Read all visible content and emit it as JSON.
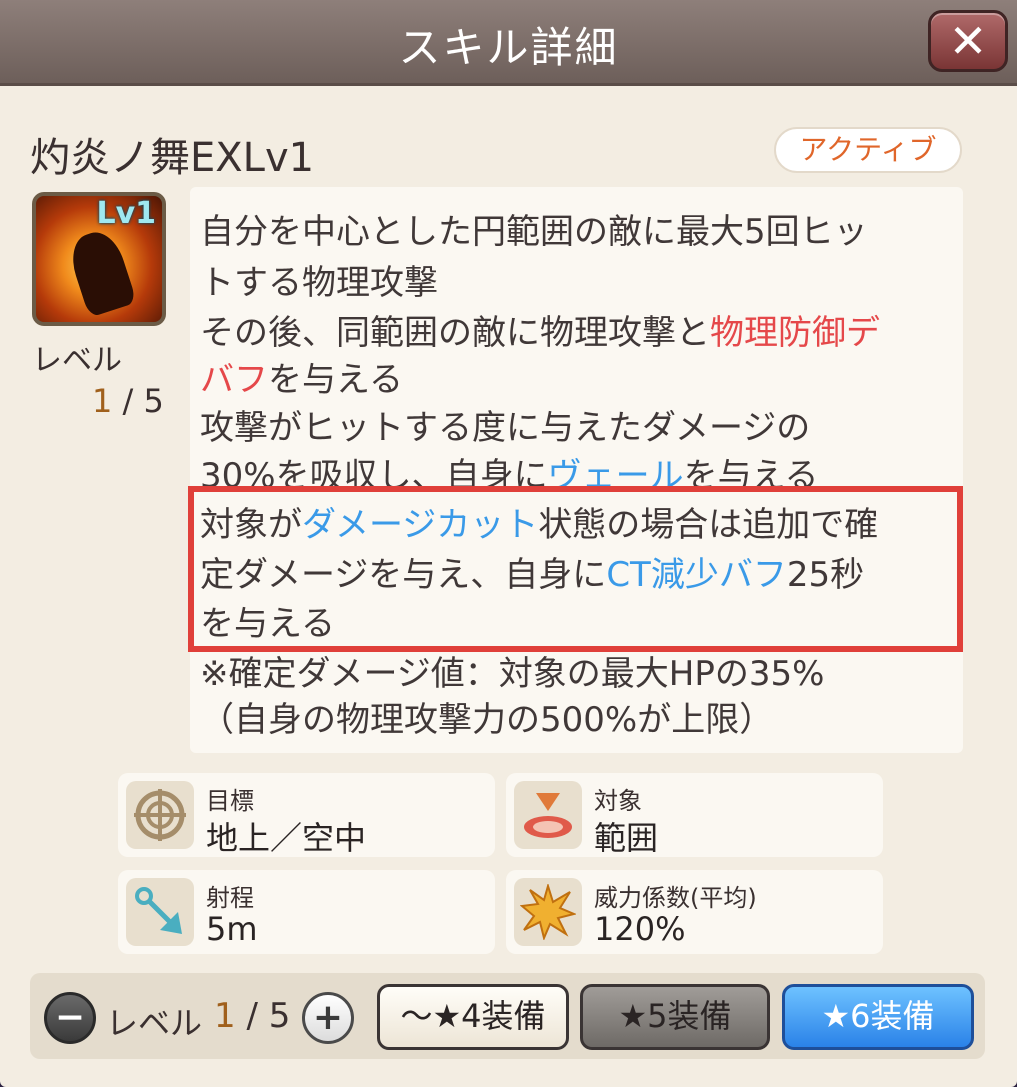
{
  "header": {
    "title": "スキル詳細"
  },
  "close_button": {
    "label": "✕"
  },
  "skill": {
    "name": "灼炎ノ舞EXLv1",
    "type_badge": "アクティブ",
    "icon_badge": "Lv1",
    "level_label": "レベル",
    "level_current": "1",
    "level_max": " / 5"
  },
  "description": {
    "line1": "自分を中心とした円範囲の敵に最大5回ヒッ",
    "line2": "トする物理攻撃",
    "line3_a": "その後、同範囲の敵に物理攻撃と",
    "line3_b": "物理防御デ",
    "line4_a": "バフ",
    "line4_b": "を与える",
    "line5": "攻撃がヒットする度に与えたダメージの",
    "line6_a": "30%を吸収し、自身に",
    "line6_b": "ヴェール",
    "line6_c": "を与える",
    "line7_a": "対象が",
    "line7_b": "ダメージカット",
    "line7_c": "状態の場合は追加で確",
    "line8_a": "定ダメージを与え、自身に",
    "line8_b": "CT減少バフ",
    "line8_c": "25秒",
    "line9": "を与える",
    "line10": "※確定ダメージ値：対象の最大HPの35%",
    "line11": "（自身の物理攻撃力の500%が上限）",
    "colors": {
      "debuff": "#e5484a",
      "buff": "#3a9ae8",
      "highlight_frame": "#e0403a"
    }
  },
  "stats": [
    {
      "icon": "crosshair-icon",
      "label": "目標",
      "value": "地上／空中"
    },
    {
      "icon": "area-target-icon",
      "label": "対象",
      "value": "範囲"
    },
    {
      "icon": "arrow-icon",
      "label": "射程",
      "value": "5m"
    },
    {
      "icon": "burst-icon",
      "label": "威力係数(平均)",
      "value": "120%"
    }
  ],
  "bottom": {
    "minus": "−",
    "plus": "+",
    "level_label": "レベル",
    "level_current": "1",
    "level_max": " / 5",
    "equip_buttons": [
      "～★4装備",
      "★5装備",
      "★6装備"
    ]
  }
}
